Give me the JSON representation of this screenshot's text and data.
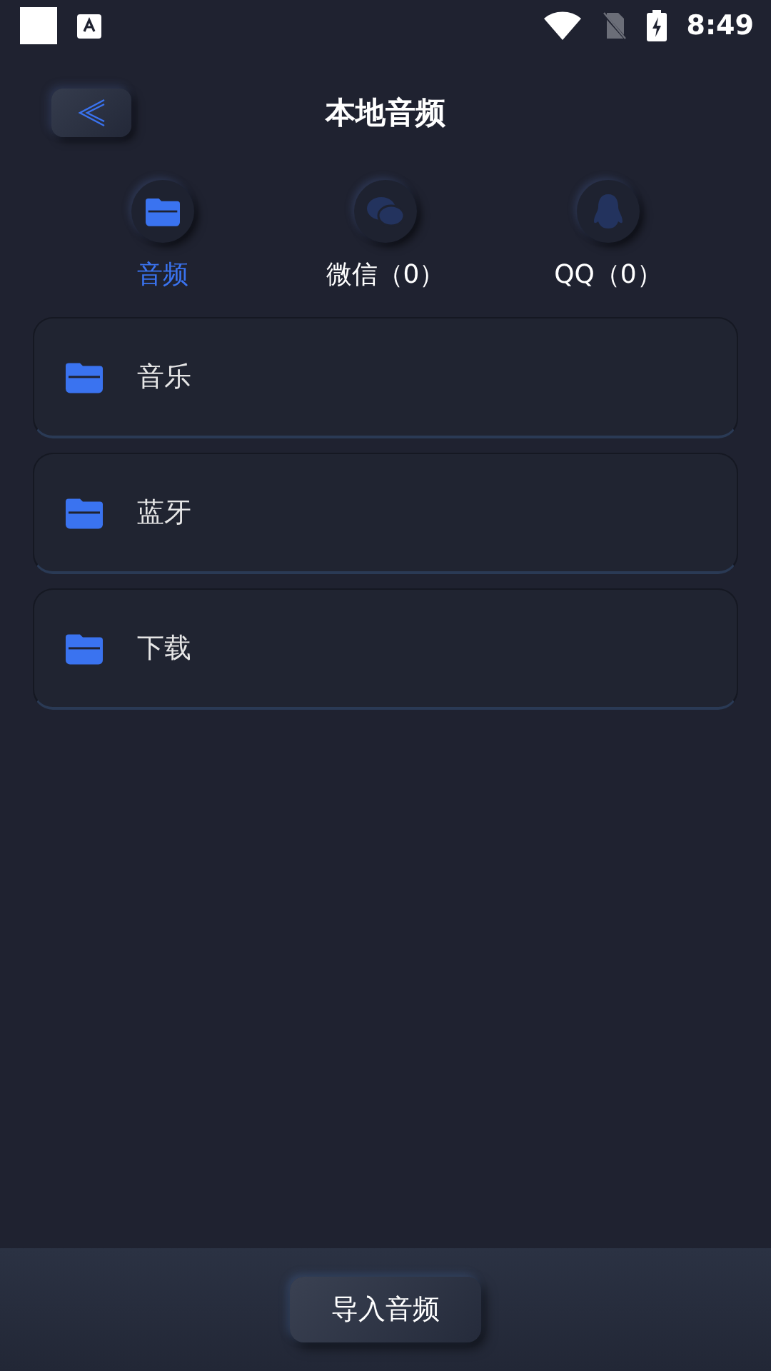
{
  "status_bar": {
    "time": "8:49"
  },
  "header": {
    "title": "本地音频"
  },
  "tabs": [
    {
      "kind": "folder",
      "label": "音频",
      "selected": true
    },
    {
      "kind": "chat",
      "label": "微信（0）",
      "selected": false
    },
    {
      "kind": "penguin",
      "label": "QQ（0）",
      "selected": false
    }
  ],
  "folders": [
    {
      "name": "音乐"
    },
    {
      "name": "蓝牙"
    },
    {
      "name": "下载"
    }
  ],
  "bottom_bar": {
    "button": "导入音频"
  }
}
